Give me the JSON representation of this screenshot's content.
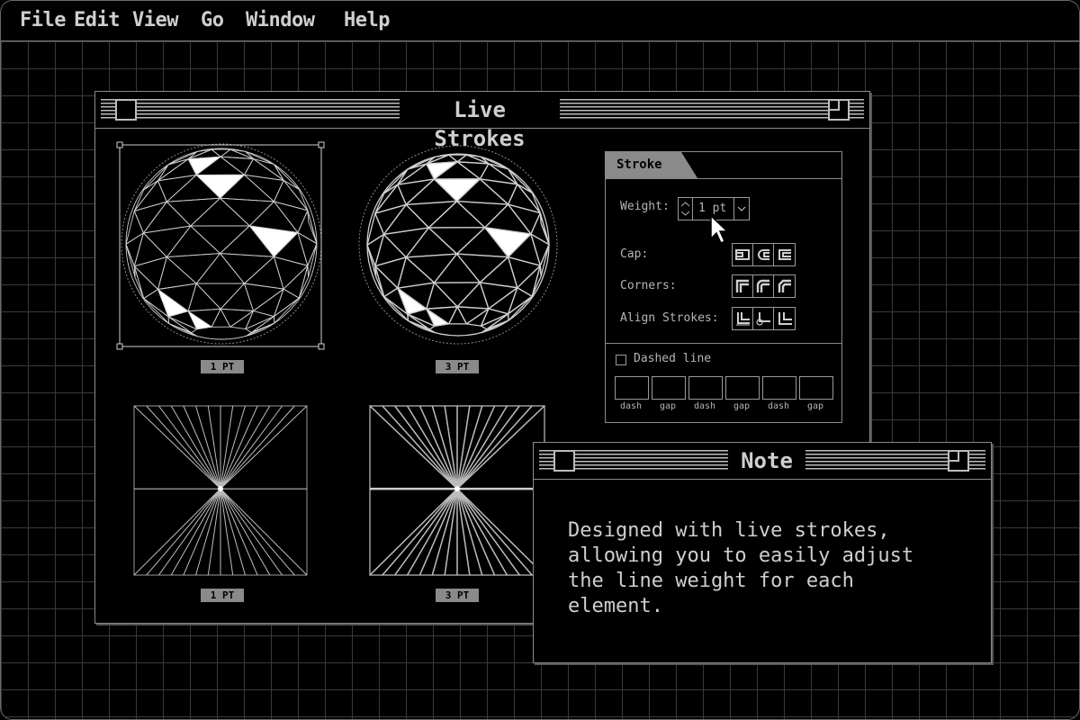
{
  "menu": {
    "items": [
      "File",
      "Edit",
      "View",
      "Go",
      "Window",
      "Help"
    ]
  },
  "main_window": {
    "title": "Live Strokes",
    "previews": [
      {
        "label": "1 PT"
      },
      {
        "label": "3 PT"
      },
      {
        "label": "1 PT"
      },
      {
        "label": "3 PT"
      }
    ]
  },
  "stroke_panel": {
    "tab": "Stroke",
    "weight_label": "Weight:",
    "weight_value": "1 pt",
    "cap_label": "Cap:",
    "corners_label": "Corners:",
    "align_label": "Align Strokes:",
    "dashed_label": "Dashed line",
    "dashed_checked": false,
    "dash_fields": [
      "dash",
      "gap",
      "dash",
      "gap",
      "dash",
      "gap"
    ]
  },
  "note_window": {
    "title": "Note",
    "text": "Designed with live strokes,\nallowing you to easily adjust\nthe line weight for each\nelement."
  },
  "icons": {
    "cursor": "arrow-cursor-icon",
    "close": "close-box-icon",
    "zoom": "zoom-box-icon"
  },
  "colors": {
    "background": "#000000",
    "grid": "#3a3a3a",
    "foreground": "#cfcfcf",
    "label_bg": "#8a8a8a"
  }
}
